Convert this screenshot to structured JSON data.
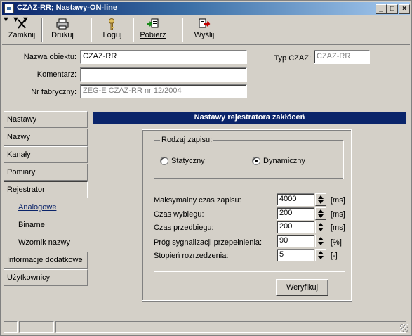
{
  "window": {
    "title": "CZAZ-RR; Nastawy-ON-line"
  },
  "titlebar_buttons": {
    "minimize": "_",
    "maximize": "□",
    "close": "×"
  },
  "toolbar": {
    "close_label": "Zamknij",
    "print_label": "Drukuj",
    "login_label": "Loguj",
    "fetch_label": "Pobierz",
    "send_label": "Wyślij"
  },
  "form": {
    "object_name_label": "Nazwa obiektu:",
    "object_name_value": "CZAZ-RR",
    "comment_label": "Komentarz:",
    "comment_value": "",
    "serial_label": "Nr fabryczny:",
    "serial_value": "ZEG-E CZAZ-RR nr 12/2004",
    "type_label": "Typ CZAZ:",
    "type_value": "CZAZ-RR"
  },
  "nav": {
    "items": [
      {
        "label": "Nastawy"
      },
      {
        "label": "Nazwy"
      },
      {
        "label": "Kanały"
      },
      {
        "label": "Pomiary"
      },
      {
        "label": "Rejestrator"
      },
      {
        "label": "Analogowe"
      },
      {
        "label": "Binarne"
      },
      {
        "label": "Wzornik nazwy"
      },
      {
        "label": "Informacje dodatkowe"
      },
      {
        "label": "Użytkownicy"
      }
    ],
    "selected": "Rejestrator"
  },
  "section": {
    "header": "Nastawy rejestratora zakłóceń",
    "mode_group_label": "Rodzaj zapisu:",
    "mode_static": "Statyczny",
    "mode_dynamic": "Dynamiczny",
    "mode_selected": "Dynamiczny",
    "params": [
      {
        "label": "Maksymalny czas zapisu:",
        "value": "4000",
        "unit": "[ms]"
      },
      {
        "label": "Czas wybiegu:",
        "value": "200",
        "unit": "[ms]"
      },
      {
        "label": "Czas przedbiegu:",
        "value": "200",
        "unit": "[ms]"
      },
      {
        "label": "Próg sygnalizacji przepełnienia:",
        "value": "90",
        "unit": "[%]"
      },
      {
        "label": "Stopień rozrzedzenia:",
        "value": "5",
        "unit": "[-]"
      }
    ],
    "verify_button": "Weryfikuj"
  },
  "colors": {
    "title_bar": "#0a246a",
    "section_header": "#0a246a",
    "window_face": "#d4d0c8"
  }
}
